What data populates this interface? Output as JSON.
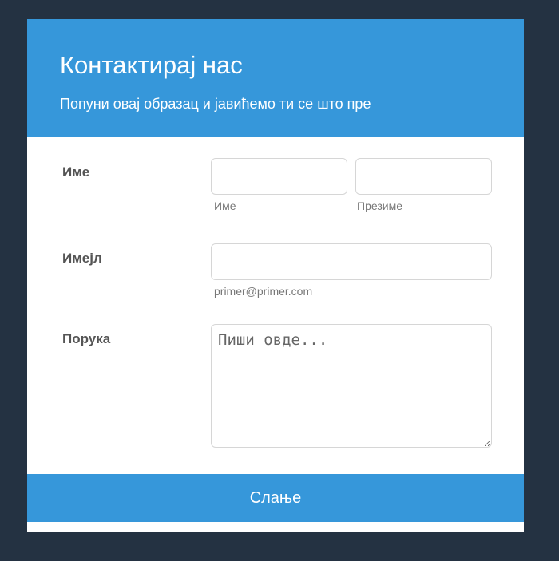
{
  "header": {
    "title": "Контактирај нас",
    "subtitle": "Попуни овај образац и јавићемо ти се што пре"
  },
  "form": {
    "name": {
      "label": "Име",
      "first_sublabel": "Име",
      "last_sublabel": "Презиме",
      "first_value": "",
      "last_value": ""
    },
    "email": {
      "label": "Имејл",
      "sublabel": "primer@primer.com",
      "value": ""
    },
    "message": {
      "label": "Порука",
      "placeholder": "Пиши овде..."
    },
    "submit_label": "Слање"
  },
  "colors": {
    "accent": "#3697da",
    "background": "#243242"
  }
}
